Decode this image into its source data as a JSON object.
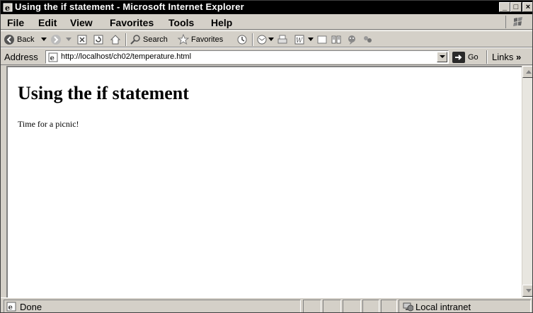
{
  "window": {
    "title": "Using the if statement - Microsoft Internet Explorer",
    "controls": {
      "minimize": "_",
      "maximize": "□",
      "close": "×"
    }
  },
  "menubar": {
    "items": [
      "File",
      "Edit",
      "View",
      "Favorites",
      "Tools",
      "Help"
    ]
  },
  "toolbar": {
    "back_label": "Back",
    "search_label": "Search",
    "favorites_label": "Favorites"
  },
  "addressbar": {
    "label": "Address",
    "url": "http://localhost/ch02/temperature.html",
    "go_label": "Go",
    "links_label": "Links"
  },
  "page": {
    "heading": "Using the if statement",
    "body_text": "Time for a picnic!"
  },
  "statusbar": {
    "status": "Done",
    "zone": "Local intranet"
  }
}
